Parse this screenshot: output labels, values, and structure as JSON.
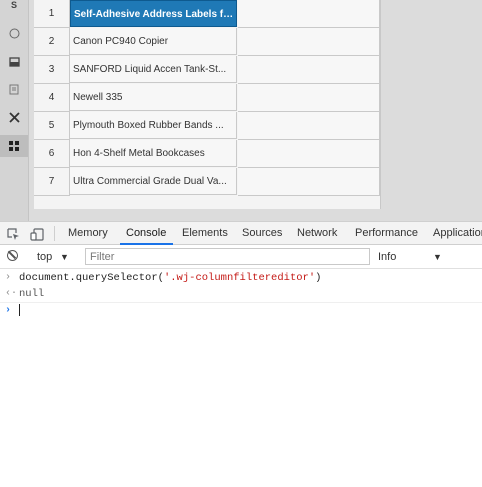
{
  "sidebar": {
    "top_letter": "S",
    "icons": [
      "compass-icon",
      "inbox-icon",
      "document-icon",
      "tools-icon",
      "grid-icon"
    ]
  },
  "grid": {
    "rows": [
      {
        "num": "1",
        "name": "Self-Adhesive Address Labels for...",
        "selected": true
      },
      {
        "num": "2",
        "name": "Canon PC940 Copier"
      },
      {
        "num": "3",
        "name": "SANFORD Liquid Accen Tank-St..."
      },
      {
        "num": "4",
        "name": "Newell 335"
      },
      {
        "num": "5",
        "name": "Plymouth Boxed Rubber Bands ..."
      },
      {
        "num": "6",
        "name": "Hon 4-Shelf Metal Bookcases"
      },
      {
        "num": "7",
        "name": "Ultra Commercial Grade Dual Va..."
      }
    ]
  },
  "devtools": {
    "tabs": [
      "Memory",
      "Console",
      "Elements",
      "Sources",
      "Network",
      "Performance",
      "Application"
    ],
    "active_tab": "Console",
    "toolbar": {
      "context": "top",
      "filter_placeholder": "Filter",
      "level": "Info"
    },
    "console": {
      "command_prefix": "document.querySelector(",
      "command_arg": "'.wj-columnfiltereditor'",
      "command_suffix": ")",
      "result": "null"
    }
  },
  "colors": {
    "accent": "#1a73e8",
    "selected_cell": "#1f79b6",
    "string": "#c41a16"
  }
}
